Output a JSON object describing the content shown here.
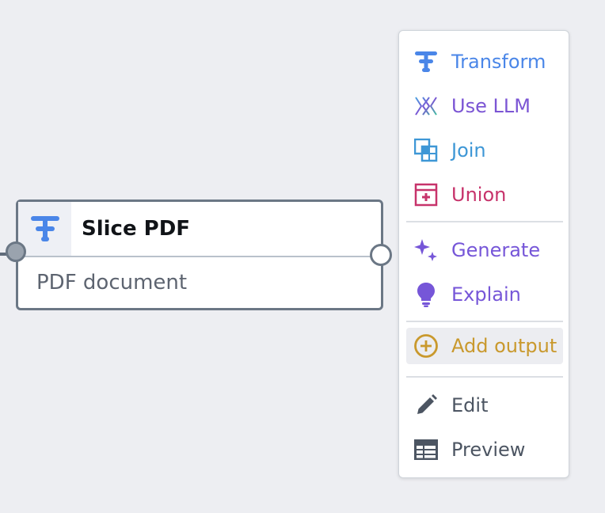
{
  "node": {
    "title": "Slice PDF",
    "subtitle": "PDF document",
    "icon": "transform-icon",
    "accent": "#4a86e8"
  },
  "menu": {
    "items": [
      {
        "label": "Transform",
        "icon": "transform-icon",
        "color": "#4a86e8"
      },
      {
        "label": "Use LLM",
        "icon": "llm-icon",
        "color": "#7b55d4"
      },
      {
        "label": "Join",
        "icon": "join-icon",
        "color": "#3e97d6"
      },
      {
        "label": "Union",
        "icon": "union-icon",
        "color": "#c7336b"
      },
      {
        "label": "Generate",
        "icon": "sparkle-icon",
        "color": "#7656d8"
      },
      {
        "label": "Explain",
        "icon": "lightbulb-icon",
        "color": "#7656d8"
      },
      {
        "label": "Add output",
        "icon": "add-circle-icon",
        "color": "#c9992d"
      },
      {
        "label": "Edit",
        "icon": "pencil-icon",
        "color": "#4c5562"
      },
      {
        "label": "Preview",
        "icon": "table-icon",
        "color": "#4c5562"
      }
    ],
    "hovered_item": "Add output"
  },
  "colors": {
    "canvas": "#edeef2",
    "node_border": "#6b7785"
  }
}
